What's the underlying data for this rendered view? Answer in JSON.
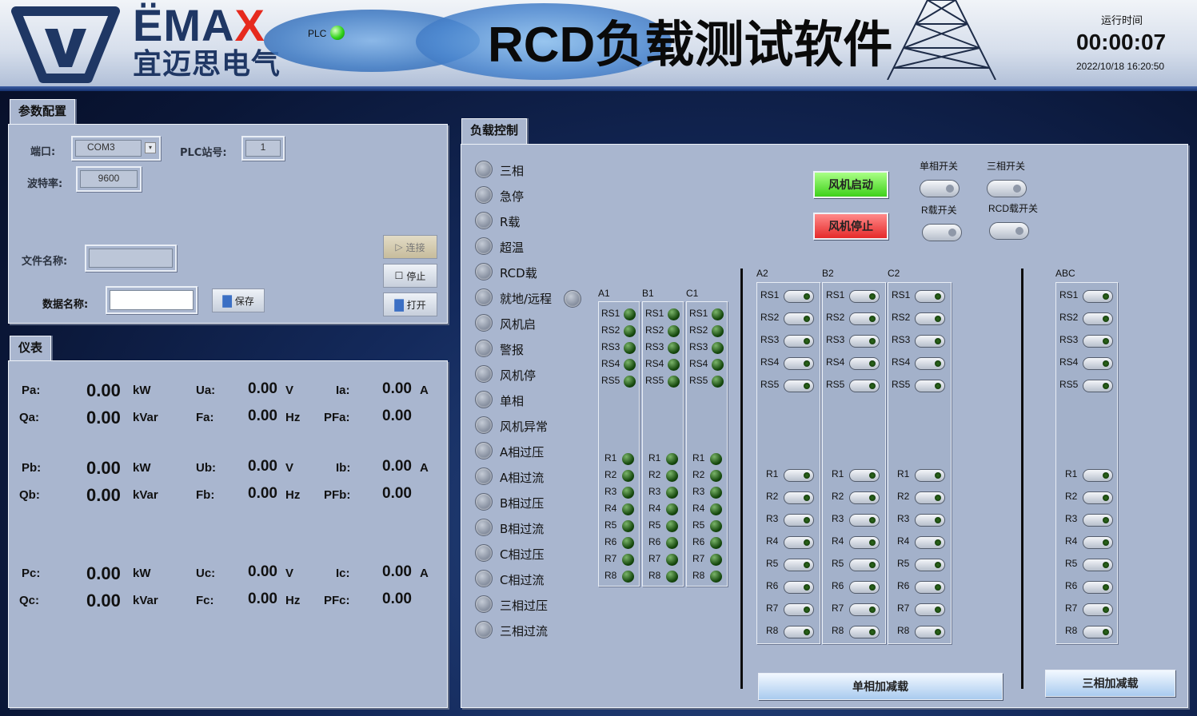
{
  "header": {
    "brand_latin": "ËMA",
    "brand_accent": "X",
    "brand_cn": "宜迈思电气",
    "plc_label": "PLC",
    "title": "RCD负载测试软件",
    "run_label": "运行时间",
    "run_time": "00:00:07",
    "run_date": "2022/10/18 16:20:50"
  },
  "config": {
    "tab": "参数配置",
    "port_label": "端口:",
    "port_value": "COM3",
    "plc_station_label": "PLC站号:",
    "plc_station_value": "1",
    "baud_label": "波特率:",
    "baud_value": "9600",
    "file_label": "文件名称:",
    "file_value": "",
    "data_label": "数据名称:",
    "data_value": "",
    "save_btn": "保存",
    "connect_btn": "连接",
    "stop_btn": "停止",
    "open_btn": "打开"
  },
  "meter": {
    "tab": "仪表",
    "rows": [
      [
        {
          "k": "Pa:",
          "v": "0.00",
          "u": "kW"
        },
        {
          "k": "Ua:",
          "v": "0.00",
          "u": "V"
        },
        {
          "k": "Ia:",
          "v": "0.00",
          "u": "A"
        }
      ],
      [
        {
          "k": "Qa:",
          "v": "0.00",
          "u": "kVar"
        },
        {
          "k": "Fa:",
          "v": "0.00",
          "u": "Hz"
        },
        {
          "k": "PFa:",
          "v": "0.00",
          "u": ""
        }
      ],
      [
        {
          "k": "Pb:",
          "v": "0.00",
          "u": "kW"
        },
        {
          "k": "Ub:",
          "v": "0.00",
          "u": "V"
        },
        {
          "k": "Ib:",
          "v": "0.00",
          "u": "A"
        }
      ],
      [
        {
          "k": "Qb:",
          "v": "0.00",
          "u": "kVar"
        },
        {
          "k": "Fb:",
          "v": "0.00",
          "u": "Hz"
        },
        {
          "k": "PFb:",
          "v": "0.00",
          "u": ""
        }
      ],
      [
        {
          "k": "Pc:",
          "v": "0.00",
          "u": "kW"
        },
        {
          "k": "Uc:",
          "v": "0.00",
          "u": "V"
        },
        {
          "k": "Ic:",
          "v": "0.00",
          "u": "A"
        }
      ],
      [
        {
          "k": "Qc:",
          "v": "0.00",
          "u": "kVar"
        },
        {
          "k": "Fc:",
          "v": "0.00",
          "u": "Hz"
        },
        {
          "k": "PFc:",
          "v": "0.00",
          "u": ""
        }
      ]
    ]
  },
  "load": {
    "tab": "负载控制",
    "indicators": [
      "三相",
      "急停",
      "R载",
      "超温",
      "RCD载",
      "就地/远程",
      "风机启",
      "警报",
      "风机停",
      "单相",
      "风机异常",
      "A相过压",
      "A相过流",
      "B相过压",
      "B相过流",
      "C相过压",
      "C相过流",
      "三相过压",
      "三相过流"
    ],
    "fan_start": "风机启动",
    "fan_stop": "风机停止",
    "switch_labels": [
      "单相开关",
      "三相开关",
      "R载开关",
      "RCD载开关"
    ],
    "led_groups": [
      "A1",
      "B1",
      "C1"
    ],
    "switch_groups": [
      "A2",
      "B2",
      "C2"
    ],
    "abc_group": "ABC",
    "rs_labels": [
      "RS1",
      "RS2",
      "RS3",
      "RS4",
      "RS5"
    ],
    "r_labels": [
      "R1",
      "R2",
      "R3",
      "R4",
      "R5",
      "R6",
      "R7",
      "R8"
    ],
    "single_btn": "单相加减载",
    "three_btn": "三相加减载"
  },
  "colors": {
    "panel": "#a9b6cf",
    "fan_start": "#5fe03c",
    "fan_stop": "#ef3b3b",
    "led_off": "#14470c"
  }
}
